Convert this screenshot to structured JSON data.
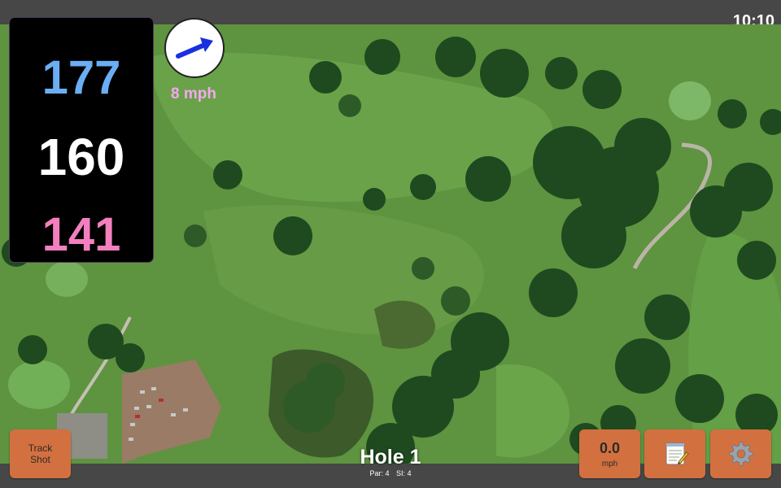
{
  "status_bar": {
    "time": "10:10"
  },
  "distances": {
    "back": "177",
    "middle": "160",
    "front": "141"
  },
  "wind": {
    "speed_label": "8 mph",
    "direction_icon": "blue-arrow-icon"
  },
  "hole": {
    "title": "Hole 1",
    "par_label": "Par: 4",
    "si_label": "SI: 4"
  },
  "buttons": {
    "track_shot": "Track Shot",
    "wind_value": "0.0",
    "wind_unit": "mph",
    "notes_icon": "notepad-icon",
    "settings_icon": "gear-icon"
  },
  "colors": {
    "back_distance": "#6aaef3",
    "middle_distance": "#ffffff",
    "front_distance": "#f47fbf",
    "wind_label": "#f4a8f0",
    "button_bg": "#d3703f",
    "arrow": "#1a2fe0"
  }
}
